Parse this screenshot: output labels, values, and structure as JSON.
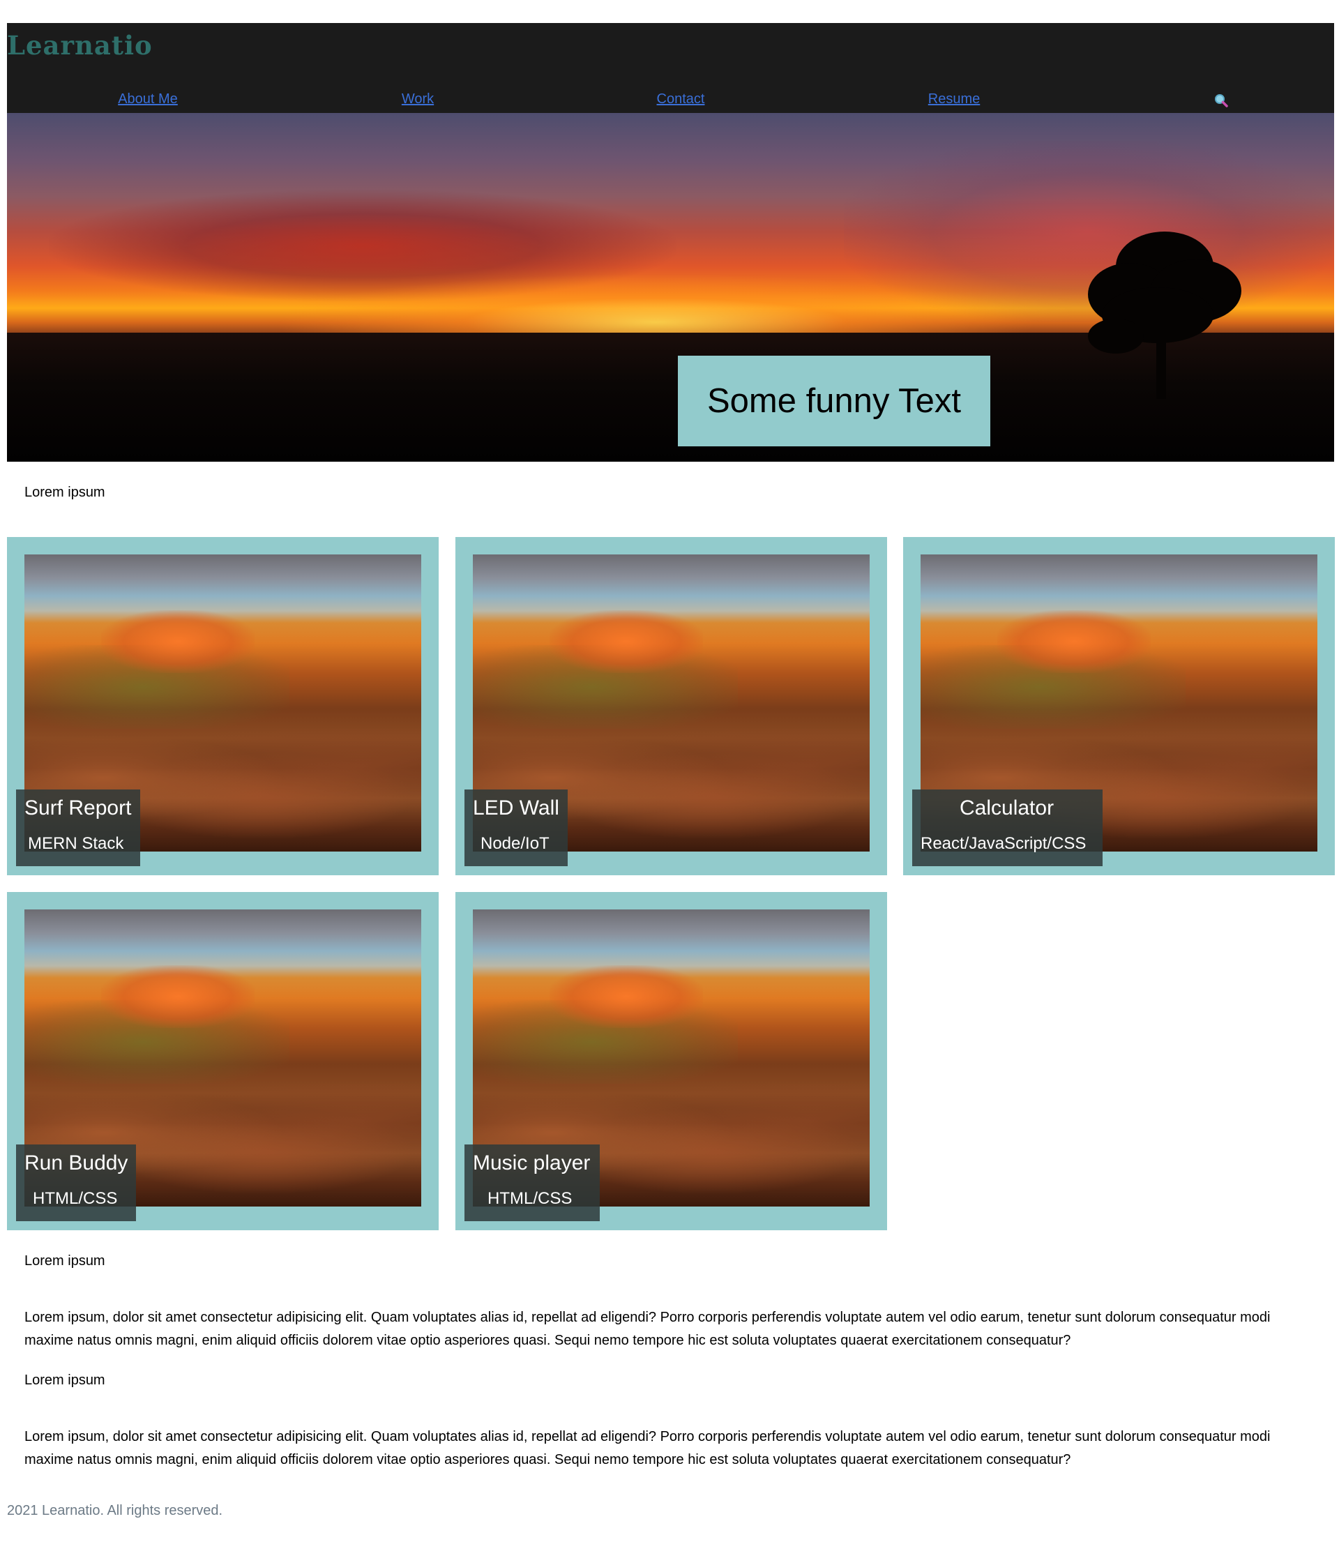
{
  "header": {
    "brand": "Learnatio",
    "nav": [
      {
        "label": "About Me"
      },
      {
        "label": "Work"
      },
      {
        "label": "Contact"
      },
      {
        "label": "Resume"
      }
    ],
    "search_icon": "magnifier-icon"
  },
  "hero": {
    "text": "Some funny Text"
  },
  "sections": {
    "intro_heading": "Lorem ipsum",
    "second_heading": "Lorem ipsum",
    "paragraph_1": "Lorem ipsum, dolor sit amet consectetur adipisicing elit. Quam voluptates alias id, repellat ad eligendi? Porro corporis perferendis voluptate autem vel odio earum, tenetur sunt dolorum consequatur modi maxime natus omnis magni, enim aliquid officiis dolorem vitae optio asperiores quasi. Sequi nemo tempore hic est soluta voluptates quaerat exercitationem consequatur?",
    "third_heading": "Lorem ipsum",
    "paragraph_2": "Lorem ipsum, dolor sit amet consectetur adipisicing elit. Quam voluptates alias id, repellat ad eligendi? Porro corporis perferendis voluptate autem vel odio earum, tenetur sunt dolorum consequatur modi maxime natus omnis magni, enim aliquid officiis dolorem vitae optio asperiores quasi. Sequi nemo tempore hic est soluta voluptates quaerat exercitationem consequatur?"
  },
  "projects": [
    {
      "title": "Surf Report",
      "stack": "MERN Stack"
    },
    {
      "title": "LED Wall",
      "stack": "Node/IoT"
    },
    {
      "title": "Calculator",
      "stack": "React/JavaScript/CSS"
    },
    {
      "title": "Run Buddy",
      "stack": "HTML/CSS"
    },
    {
      "title": "Music player",
      "stack": "HTML/CSS"
    }
  ],
  "footer": {
    "text": "2021 Learnatio. All rights reserved."
  },
  "colors": {
    "header_bg": "#1b1b1b",
    "brand": "#2e6f6a",
    "link": "#3a6fd8",
    "card_bg": "#92cbcc",
    "caption_bg": "#2e3a3a",
    "footer_text": "#6c7a86"
  }
}
